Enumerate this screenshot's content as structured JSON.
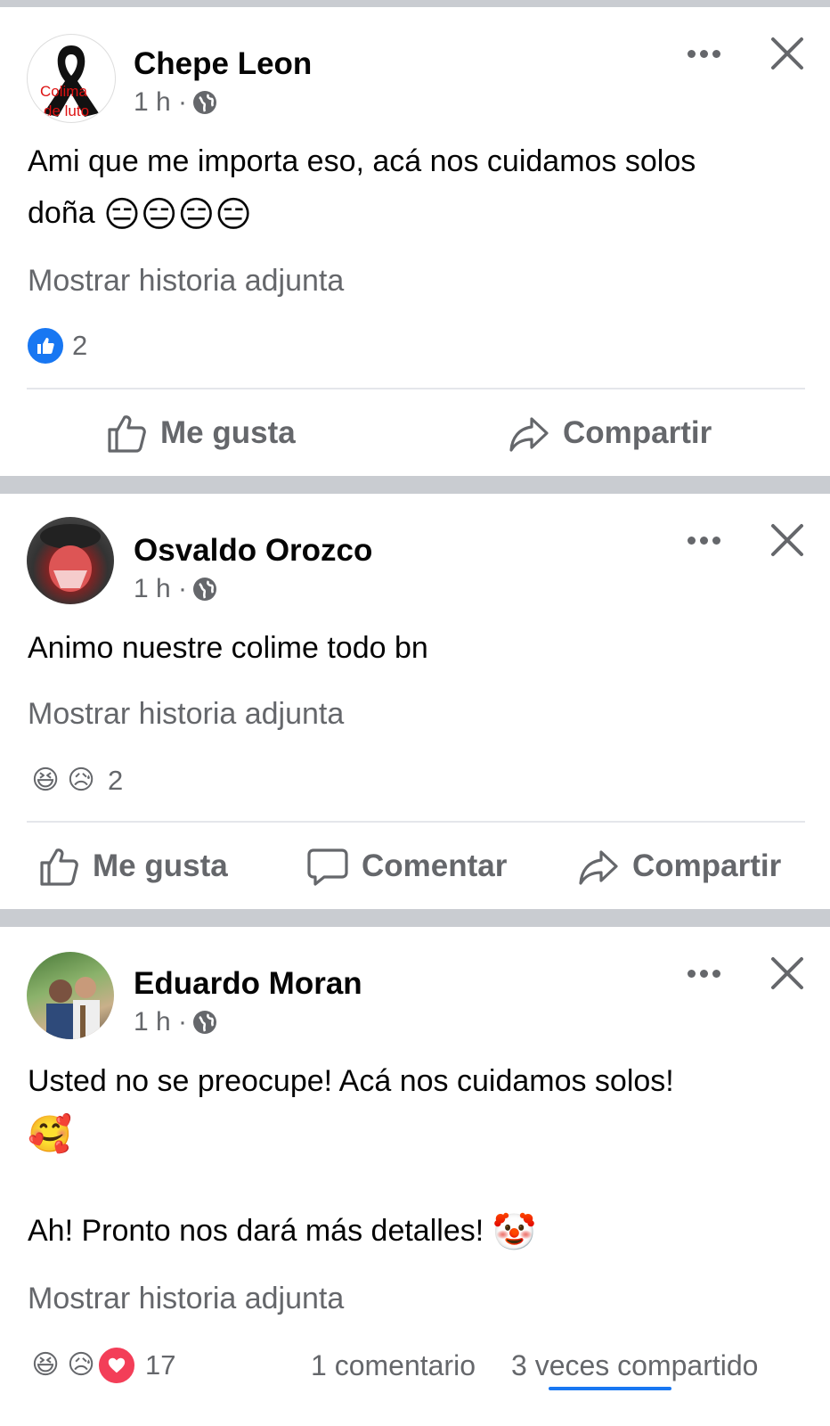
{
  "posts": [
    {
      "author": "Chepe Leon",
      "avatar_text_1": "Colima",
      "avatar_text_2": "de luto",
      "time": "1 h ·",
      "text_line1": "Ami que me importa eso, acá nos cuidamos solos",
      "text_line2": "doña",
      "emojis": "😑😑😑😑",
      "story_link": "Mostrar historia adjunta",
      "reaction_count": "2",
      "like_label": "Me gusta",
      "share_label": "Compartir"
    },
    {
      "author": "Osvaldo Orozco",
      "time": "1 h ·",
      "text_line1": "Animo nuestre colime todo bn",
      "story_link": "Mostrar historia adjunta",
      "reaction_count": "2",
      "like_label": "Me gusta",
      "comment_label": "Comentar",
      "share_label": "Compartir"
    },
    {
      "author": "Eduardo Moran",
      "time": "1 h ·",
      "text_line1": "Usted no se preocupe! Acá nos cuidamos solos!",
      "emoji_line2": "🥰",
      "text_line3": "Ah! Pronto nos dará más detalles!",
      "emoji_line3": "🤡",
      "story_link": "Mostrar historia adjunta",
      "reaction_count": "17",
      "comments_count": "1 comentario",
      "shares_count": "3 veces compartido"
    }
  ],
  "colors": {
    "like_blue": "#1877f2",
    "love_red": "#f33e58",
    "haha_yellow": "#f7b125",
    "muted_text": "#65676b",
    "separator": "#c9ccd1"
  },
  "icons": {
    "close": "close-icon",
    "more": "more-dots-icon",
    "globe": "globe-icon",
    "like": "thumbs-up-icon",
    "comment": "comment-bubble-icon",
    "share": "share-arrow-icon"
  }
}
